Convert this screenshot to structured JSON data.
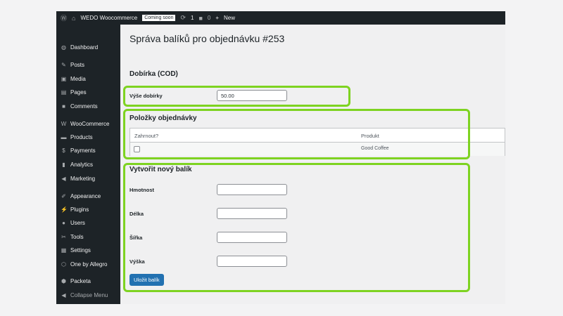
{
  "adminbar": {
    "site": "WEDO Woocommerce",
    "badge": "Coming soon",
    "updates": "1",
    "comments": "0",
    "new": "New"
  },
  "sidebar": [
    {
      "label": "Dashboard",
      "icon": "dashboard-icon",
      "glyph": "◍"
    },
    {
      "label": "Posts",
      "icon": "pin-icon",
      "glyph": "✎"
    },
    {
      "label": "Media",
      "icon": "media-icon",
      "glyph": "▣"
    },
    {
      "label": "Pages",
      "icon": "pages-icon",
      "glyph": "▤"
    },
    {
      "label": "Comments",
      "icon": "comment-icon",
      "glyph": "■"
    },
    {
      "label": "WooCommerce",
      "icon": "woo-icon",
      "glyph": "W"
    },
    {
      "label": "Products",
      "icon": "products-icon",
      "glyph": "▬"
    },
    {
      "label": "Payments",
      "icon": "payments-icon",
      "glyph": "$"
    },
    {
      "label": "Analytics",
      "icon": "analytics-icon",
      "glyph": "▮"
    },
    {
      "label": "Marketing",
      "icon": "megaphone-icon",
      "glyph": "◀"
    },
    {
      "label": "Appearance",
      "icon": "brush-icon",
      "glyph": "✐"
    },
    {
      "label": "Plugins",
      "icon": "plug-icon",
      "glyph": "⚡"
    },
    {
      "label": "Users",
      "icon": "user-icon",
      "glyph": "●"
    },
    {
      "label": "Tools",
      "icon": "wrench-icon",
      "glyph": "✂"
    },
    {
      "label": "Settings",
      "icon": "settings-icon",
      "glyph": "▦"
    },
    {
      "label": "One by Allegro",
      "icon": "allegro-icon",
      "glyph": "⬡"
    },
    {
      "label": "Packeta",
      "icon": "packeta-icon",
      "glyph": "⬢"
    },
    {
      "label": "Collapse Menu",
      "icon": "collapse-icon",
      "glyph": "◀"
    }
  ],
  "page": {
    "title": "Správa balíků pro objednávku #253",
    "cod_heading": "Dobírka (COD)",
    "cod_label": "Výše dobírky",
    "cod_value": "50.00",
    "items_heading": "Položky objednávky",
    "col_include": "Zahrnout?",
    "col_product": "Produkt",
    "product": "Good Coffee",
    "new_heading": "Vytvořit nový balík",
    "weight": "Hmotnost",
    "length": "Délka",
    "width": "Šířka",
    "height": "Výška",
    "save": "Uložit balík"
  },
  "colors": {
    "highlight": "#7ed321",
    "accent": "#2271b1"
  }
}
